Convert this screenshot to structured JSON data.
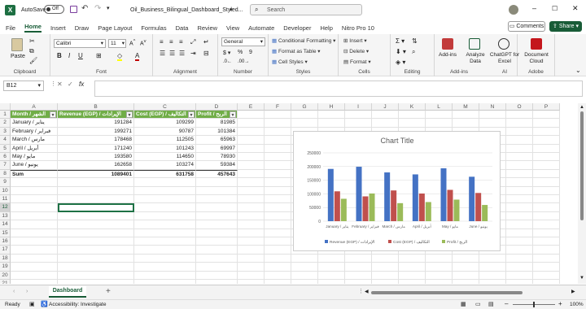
{
  "window": {
    "autosave": "AutoSave",
    "autosave_state": "Off",
    "file_title": "Oil_Business_Bilingual_Dashboard_Styled...",
    "search_placeholder": "Search"
  },
  "tabs": [
    "File",
    "Home",
    "Insert",
    "Draw",
    "Page Layout",
    "Formulas",
    "Data",
    "Review",
    "View",
    "Automate",
    "Developer",
    "Help",
    "Nitro Pro 10"
  ],
  "actions": {
    "comments": "Comments",
    "share": "Share"
  },
  "ribbon": {
    "clipboard": {
      "label": "Clipboard",
      "paste": "Paste"
    },
    "font": {
      "label": "Font",
      "font_name": "Calibri",
      "font_size": "11"
    },
    "alignment": {
      "label": "Alignment"
    },
    "number": {
      "label": "Number",
      "format": "General"
    },
    "styles": {
      "label": "Styles",
      "conditional": "Conditional Formatting",
      "format_table": "Format as Table",
      "cell_styles": "Cell Styles"
    },
    "cells": {
      "label": "Cells",
      "insert": "Insert",
      "delete": "Delete",
      "format": "Format"
    },
    "editing": {
      "label": "Editing"
    },
    "addins": {
      "label": "Add-ins",
      "addins_btn": "Add-ins",
      "analyze": "Analyze Data",
      "chatgpt": "ChatGPT for Excel"
    },
    "ai": {
      "label": "AI"
    },
    "adobe": {
      "label": "Adobe",
      "doc_cloud": "Document Cloud"
    }
  },
  "formula_bar": {
    "name_box": "B12",
    "fx": "fx",
    "value": ""
  },
  "columns": [
    "A",
    "B",
    "C",
    "D",
    "E",
    "F",
    "G",
    "H",
    "I",
    "J",
    "K",
    "L",
    "M",
    "N",
    "O",
    "P"
  ],
  "rows": [
    "1",
    "2",
    "3",
    "4",
    "5",
    "6",
    "7",
    "8",
    "9",
    "10",
    "11",
    "12",
    "13",
    "14",
    "15",
    "16",
    "17",
    "18",
    "19",
    "20",
    "21"
  ],
  "table": {
    "headers": [
      "Month / الشهر",
      "Revenue (EGP) / الإيرادات",
      "Cost (EGP) / التكاليف",
      "Profit / الربح"
    ],
    "data": [
      [
        "January / يناير",
        "191284",
        "109299",
        "81985"
      ],
      [
        "February / فبراير",
        "199271",
        "90787",
        "101384"
      ],
      [
        "March / مارس",
        "178468",
        "112505",
        "65963"
      ],
      [
        "April / أبريل",
        "171240",
        "101243",
        "69997"
      ],
      [
        "May / مايو",
        "193580",
        "114650",
        "78930"
      ],
      [
        "June / يونيو",
        "162658",
        "103274",
        "59384"
      ]
    ],
    "sum_label": "Sum",
    "sums": [
      "1089401",
      "631758",
      "457643"
    ]
  },
  "chart_data": {
    "type": "bar",
    "title": "Chart Title",
    "categories": [
      "January / يناير",
      "February / فبراير",
      "March / مارس",
      "April / أبريل",
      "May / مايو",
      "June / يونيو"
    ],
    "series": [
      {
        "name": "Revenue (EGP) / الإيرادات",
        "color": "#4472c4",
        "values": [
          191284,
          199271,
          178468,
          171240,
          193580,
          162658
        ]
      },
      {
        "name": "Cost (EGP) / التكاليف",
        "color": "#c0504d",
        "values": [
          109299,
          90787,
          112505,
          101243,
          114650,
          103274
        ]
      },
      {
        "name": "Profit / الربح",
        "color": "#9bbb59",
        "values": [
          81985,
          101384,
          65963,
          69997,
          78930,
          59384
        ]
      }
    ],
    "ylim": [
      0,
      250000
    ],
    "yticks": [
      "250000",
      "200000",
      "150000",
      "100000",
      "50000",
      "0"
    ],
    "legend": "bottom",
    "grid": true
  },
  "sheets": {
    "active": "Dashboard",
    "add": "+"
  },
  "status": {
    "ready": "Ready",
    "accessibility": "Accessibility: Investigate",
    "zoom": "100%"
  }
}
